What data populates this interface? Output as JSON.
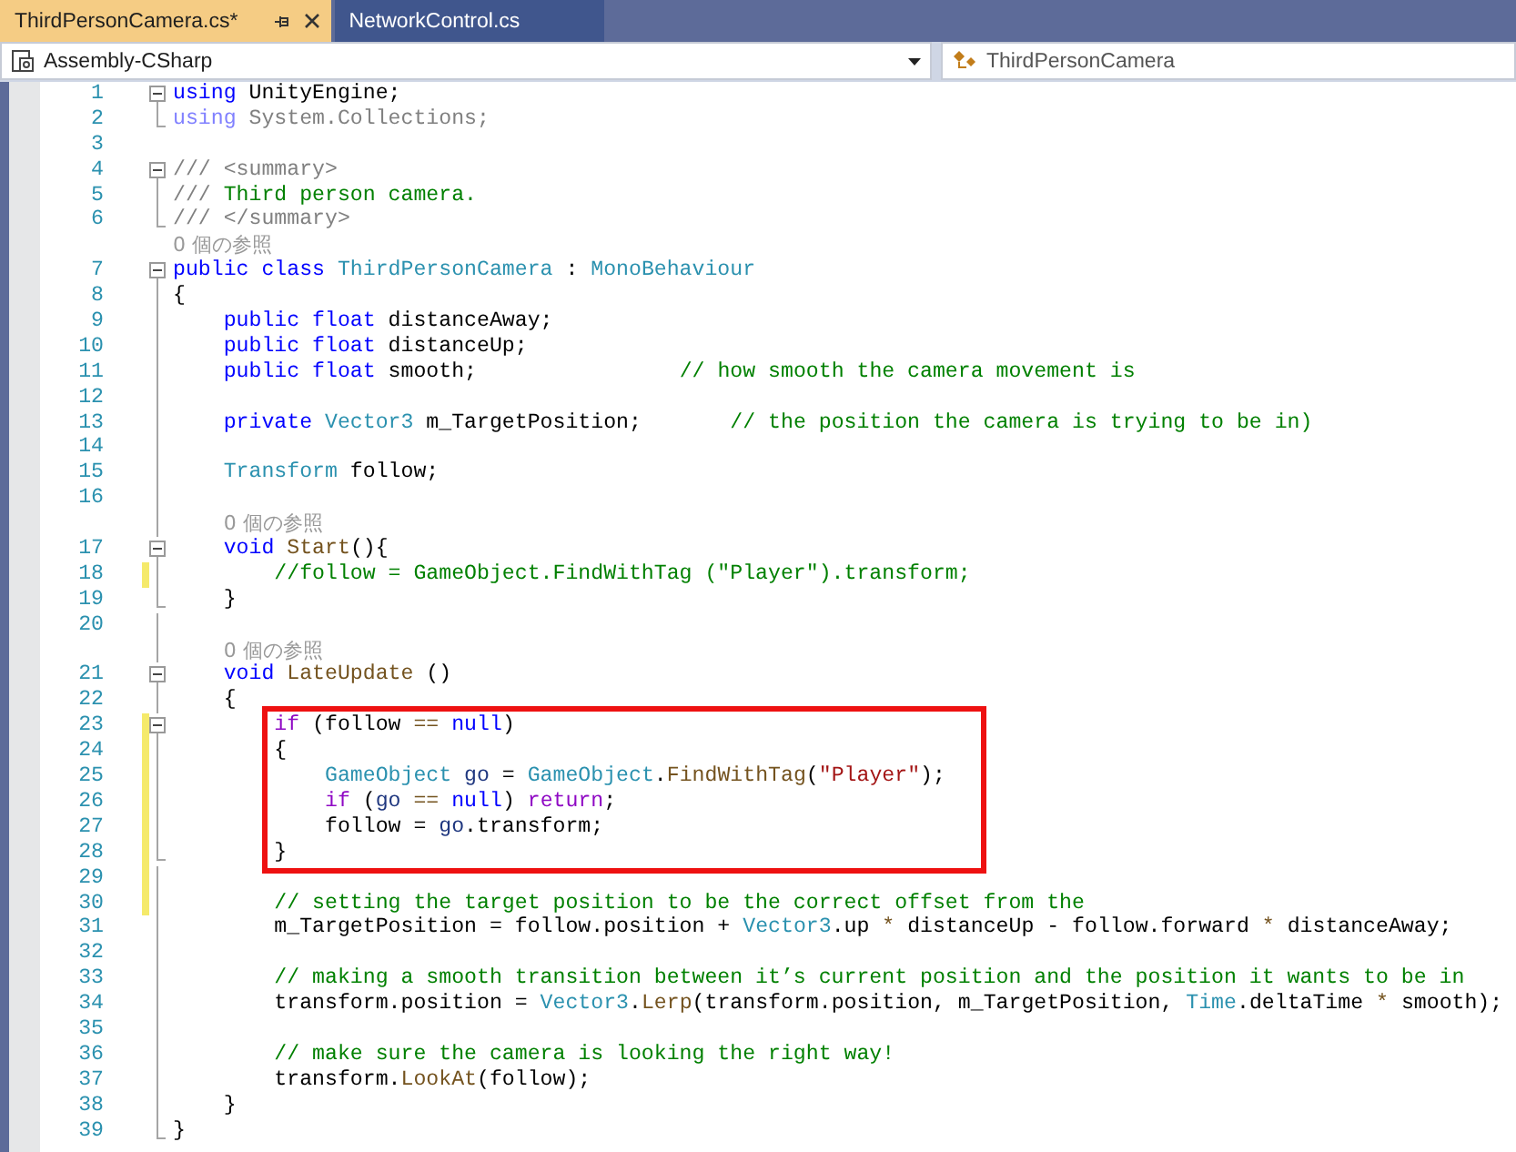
{
  "tabs": [
    {
      "label": "ThirdPersonCamera.cs*",
      "selected": true,
      "pinnable": true,
      "closable": true
    },
    {
      "label": "NetworkControl.cs",
      "selected": false,
      "pinnable": false,
      "closable": false
    }
  ],
  "navigation_bar": {
    "project_dropdown": "Assembly-CSharp",
    "type_dropdown": "ThirdPersonCamera"
  },
  "rows": [
    {
      "kind": "code",
      "number": "1",
      "fold": {
        "kind": "start"
      },
      "changed": false,
      "tokens": [
        {
          "kind": "keyword",
          "text": "using"
        },
        {
          "kind": "plain",
          "text": " UnityEngine;"
        }
      ]
    },
    {
      "kind": "code",
      "number": "2",
      "fold": {
        "kind": "end"
      },
      "changed": false,
      "tokens": [
        {
          "kind": "keyword_dim",
          "text": "using"
        },
        {
          "kind": "dim",
          "text": " System.Collections;"
        }
      ]
    },
    {
      "kind": "code",
      "number": "3",
      "changed": false,
      "tokens": []
    },
    {
      "kind": "code",
      "number": "4",
      "fold": {
        "kind": "start"
      },
      "changed": false,
      "tokens": [
        {
          "kind": "doc",
          "text": "/// <summary>"
        }
      ]
    },
    {
      "kind": "code",
      "number": "5",
      "fold": {
        "kind": "middle"
      },
      "changed": false,
      "tokens": [
        {
          "kind": "doc",
          "text": "/// "
        },
        {
          "kind": "comment",
          "text": "Third person camera."
        }
      ]
    },
    {
      "kind": "code",
      "number": "6",
      "fold": {
        "kind": "end"
      },
      "changed": false,
      "tokens": [
        {
          "kind": "doc",
          "text": "/// </summary>"
        }
      ]
    },
    {
      "kind": "codelens",
      "text": "0 個の参照",
      "changed": false
    },
    {
      "kind": "code",
      "number": "7",
      "fold": {
        "kind": "start"
      },
      "changed": false,
      "tokens": [
        {
          "kind": "keyword",
          "text": "public class "
        },
        {
          "kind": "type",
          "text": "ThirdPersonCamera"
        },
        {
          "kind": "plain",
          "text": " : "
        },
        {
          "kind": "type",
          "text": "MonoBehaviour"
        }
      ]
    },
    {
      "kind": "code",
      "number": "8",
      "fold": {
        "kind": "middle"
      },
      "changed": false,
      "tokens": [
        {
          "kind": "plain",
          "text": "{"
        }
      ]
    },
    {
      "kind": "code",
      "number": "9",
      "fold": {
        "kind": "middle"
      },
      "changed": false,
      "tokens": [
        {
          "kind": "keyword",
          "text": "    public float"
        },
        {
          "kind": "plain",
          "text": " distanceAway;"
        }
      ]
    },
    {
      "kind": "code",
      "number": "10",
      "fold": {
        "kind": "middle"
      },
      "changed": false,
      "tokens": [
        {
          "kind": "keyword",
          "text": "    public float"
        },
        {
          "kind": "plain",
          "text": " distanceUp;"
        }
      ]
    },
    {
      "kind": "code",
      "number": "11",
      "fold": {
        "kind": "middle"
      },
      "changed": false,
      "tokens": [
        {
          "kind": "keyword",
          "text": "    public float"
        },
        {
          "kind": "plain",
          "text": " smooth;                "
        },
        {
          "kind": "comment",
          "text": "// how smooth the camera movement is"
        }
      ]
    },
    {
      "kind": "code",
      "number": "12",
      "fold": {
        "kind": "middle"
      },
      "changed": false,
      "tokens": []
    },
    {
      "kind": "code",
      "number": "13",
      "fold": {
        "kind": "middle"
      },
      "changed": false,
      "tokens": [
        {
          "kind": "keyword",
          "text": "    private "
        },
        {
          "kind": "type",
          "text": "Vector3"
        },
        {
          "kind": "plain",
          "text": " m_TargetPosition;       "
        },
        {
          "kind": "comment",
          "text": "// the position the camera is trying to be in)"
        }
      ]
    },
    {
      "kind": "code",
      "number": "14",
      "fold": {
        "kind": "middle"
      },
      "changed": false,
      "tokens": []
    },
    {
      "kind": "code",
      "number": "15",
      "fold": {
        "kind": "middle"
      },
      "changed": false,
      "tokens": [
        {
          "kind": "type",
          "text": "    Transform"
        },
        {
          "kind": "plain",
          "text": " follow;"
        }
      ]
    },
    {
      "kind": "code",
      "number": "16",
      "fold": {
        "kind": "middle"
      },
      "changed": false,
      "tokens": []
    },
    {
      "kind": "codelens",
      "text": "0 個の参照",
      "indent": "    ",
      "fold": {
        "kind": "middle"
      },
      "changed": false
    },
    {
      "kind": "code",
      "number": "17",
      "fold": {
        "kind": "start"
      },
      "changed": false,
      "tokens": [
        {
          "kind": "keyword",
          "text": "    void "
        },
        {
          "kind": "method",
          "text": "Start"
        },
        {
          "kind": "plain",
          "text": "(){"
        }
      ]
    },
    {
      "kind": "code",
      "number": "18",
      "fold": {
        "kind": "middle"
      },
      "changed": true,
      "tokens": [
        {
          "kind": "comment",
          "text": "        //follow = GameObject.FindWithTag (\"Player\").transform;"
        }
      ]
    },
    {
      "kind": "code",
      "number": "19",
      "fold": {
        "kind": "end"
      },
      "changed": false,
      "tokens": [
        {
          "kind": "plain",
          "text": "    }"
        }
      ]
    },
    {
      "kind": "code",
      "number": "20",
      "fold": {
        "kind": "middle"
      },
      "changed": false,
      "tokens": []
    },
    {
      "kind": "codelens",
      "text": "0 個の参照",
      "indent": "    ",
      "fold": {
        "kind": "middle"
      },
      "changed": false
    },
    {
      "kind": "code",
      "number": "21",
      "fold": {
        "kind": "start"
      },
      "changed": false,
      "tokens": [
        {
          "kind": "keyword",
          "text": "    void "
        },
        {
          "kind": "method",
          "text": "LateUpdate"
        },
        {
          "kind": "plain",
          "text": " ()"
        }
      ]
    },
    {
      "kind": "code",
      "number": "22",
      "fold": {
        "kind": "middle"
      },
      "changed": false,
      "tokens": [
        {
          "kind": "plain",
          "text": "    {"
        }
      ]
    },
    {
      "kind": "highlight",
      "rows": [
        {
          "kind": "code",
          "number": "23",
          "fold": {
            "kind": "start"
          },
          "changed": true,
          "tokens": [
            {
              "kind": "control",
              "text": "        if"
            },
            {
              "kind": "plain",
              "text": " (follow "
            },
            {
              "kind": "method",
              "text": "=="
            },
            {
              "kind": "keyword",
              "text": " null"
            },
            {
              "kind": "plain",
              "text": ")"
            }
          ]
        },
        {
          "kind": "code",
          "number": "24",
          "fold": {
            "kind": "middle"
          },
          "changed": true,
          "tokens": [
            {
              "kind": "plain",
              "text": "        {"
            }
          ]
        },
        {
          "kind": "code",
          "number": "25",
          "fold": {
            "kind": "middle"
          },
          "changed": true,
          "tokens": [
            {
              "kind": "type",
              "text": "            GameObject"
            },
            {
              "kind": "local",
              "text": " go"
            },
            {
              "kind": "plain",
              "text": " = "
            },
            {
              "kind": "type",
              "text": "GameObject"
            },
            {
              "kind": "plain",
              "text": "."
            },
            {
              "kind": "method",
              "text": "FindWithTag"
            },
            {
              "kind": "plain",
              "text": "("
            },
            {
              "kind": "string",
              "text": "\"Player\""
            },
            {
              "kind": "plain",
              "text": ");"
            }
          ]
        },
        {
          "kind": "code",
          "number": "26",
          "fold": {
            "kind": "middle"
          },
          "changed": true,
          "tokens": [
            {
              "kind": "control",
              "text": "            if"
            },
            {
              "kind": "plain",
              "text": " ("
            },
            {
              "kind": "local",
              "text": "go"
            },
            {
              "kind": "method",
              "text": " =="
            },
            {
              "kind": "keyword",
              "text": " null"
            },
            {
              "kind": "plain",
              "text": ") "
            },
            {
              "kind": "control",
              "text": "return"
            },
            {
              "kind": "plain",
              "text": ";"
            }
          ]
        },
        {
          "kind": "code",
          "number": "27",
          "fold": {
            "kind": "middle"
          },
          "changed": true,
          "tokens": [
            {
              "kind": "plain",
              "text": "            follow = "
            },
            {
              "kind": "local",
              "text": "go"
            },
            {
              "kind": "plain",
              "text": ".transform;"
            }
          ]
        },
        {
          "kind": "code",
          "number": "28",
          "fold": {
            "kind": "end"
          },
          "changed": true,
          "tokens": [
            {
              "kind": "plain",
              "text": "        }"
            }
          ]
        }
      ]
    },
    {
      "kind": "code",
      "number": "29",
      "fold": {
        "kind": "middle"
      },
      "changed": true,
      "tokens": []
    },
    {
      "kind": "code",
      "number": "30",
      "fold": {
        "kind": "middle"
      },
      "changed": true,
      "tokens": [
        {
          "kind": "comment",
          "text": "        // setting the target position to be the correct offset from the"
        }
      ]
    },
    {
      "kind": "code",
      "number": "31",
      "fold": {
        "kind": "middle"
      },
      "changed": false,
      "tokens": [
        {
          "kind": "plain",
          "text": "        m_TargetPosition = follow.position + "
        },
        {
          "kind": "type",
          "text": "Vector3"
        },
        {
          "kind": "plain",
          "text": ".up "
        },
        {
          "kind": "method",
          "text": "*"
        },
        {
          "kind": "plain",
          "text": " distanceUp - follow.forward "
        },
        {
          "kind": "method",
          "text": "*"
        },
        {
          "kind": "plain",
          "text": " distanceAway;"
        }
      ]
    },
    {
      "kind": "code",
      "number": "32",
      "fold": {
        "kind": "middle"
      },
      "changed": false,
      "tokens": []
    },
    {
      "kind": "code",
      "number": "33",
      "fold": {
        "kind": "middle"
      },
      "changed": false,
      "tokens": [
        {
          "kind": "comment",
          "text": "        // making a smooth transition between it’s current position and the position it wants to be in"
        }
      ]
    },
    {
      "kind": "code",
      "number": "34",
      "fold": {
        "kind": "middle"
      },
      "changed": false,
      "tokens": [
        {
          "kind": "plain",
          "text": "        transform.position = "
        },
        {
          "kind": "type",
          "text": "Vector3"
        },
        {
          "kind": "plain",
          "text": "."
        },
        {
          "kind": "method",
          "text": "Lerp"
        },
        {
          "kind": "plain",
          "text": "(transform.position, m_TargetPosition, "
        },
        {
          "kind": "type",
          "text": "Time"
        },
        {
          "kind": "plain",
          "text": ".deltaTime "
        },
        {
          "kind": "method",
          "text": "*"
        },
        {
          "kind": "plain",
          "text": " smooth);"
        }
      ]
    },
    {
      "kind": "code",
      "number": "35",
      "fold": {
        "kind": "middle"
      },
      "changed": false,
      "tokens": []
    },
    {
      "kind": "code",
      "number": "36",
      "fold": {
        "kind": "middle"
      },
      "changed": false,
      "tokens": [
        {
          "kind": "comment",
          "text": "        // make sure the camera is looking the right way!"
        }
      ]
    },
    {
      "kind": "code",
      "number": "37",
      "fold": {
        "kind": "middle"
      },
      "changed": false,
      "tokens": [
        {
          "kind": "plain",
          "text": "        transform."
        },
        {
          "kind": "method",
          "text": "LookAt"
        },
        {
          "kind": "plain",
          "text": "(follow);"
        }
      ]
    },
    {
      "kind": "code",
      "number": "38",
      "fold": {
        "kind": "middle"
      },
      "changed": false,
      "tokens": [
        {
          "kind": "plain",
          "text": "    }"
        }
      ]
    },
    {
      "kind": "code",
      "number": "39",
      "fold": {
        "kind": "end"
      },
      "changed": false,
      "tokens": [
        {
          "kind": "plain",
          "text": "}"
        }
      ]
    }
  ]
}
